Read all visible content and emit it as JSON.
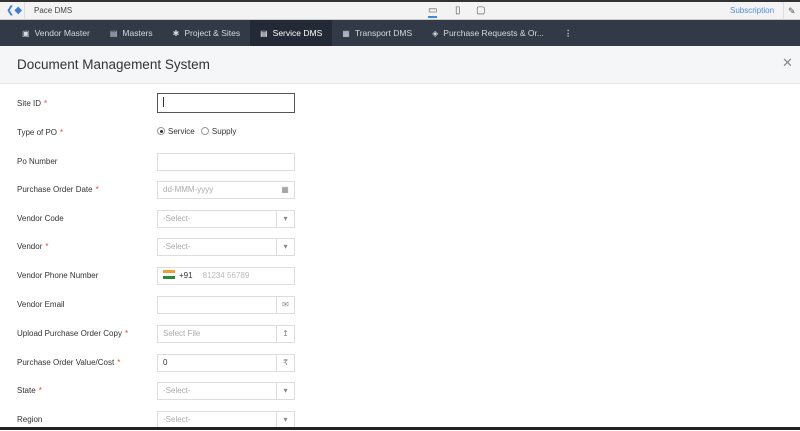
{
  "app": {
    "name": "Pace DMS",
    "subscription": "Subscription"
  },
  "nav": {
    "tabs": [
      {
        "label": "Vendor Master",
        "icon": "monitor-icon"
      },
      {
        "label": "Masters",
        "icon": "database-icon"
      },
      {
        "label": "Project & Sites",
        "icon": "bug-icon"
      },
      {
        "label": "Service DMS",
        "icon": "document-icon"
      },
      {
        "label": "Transport DMS",
        "icon": "bus-icon"
      },
      {
        "label": "Purchase Requests & Or...",
        "icon": "tag-icon"
      }
    ],
    "active": "Service DMS"
  },
  "page": {
    "title": "Document Management System"
  },
  "form": {
    "site_id": {
      "label": "Site ID",
      "value": ""
    },
    "type_of_po": {
      "label": "Type of PO",
      "options": [
        "Service",
        "Supply"
      ],
      "selected": "Service"
    },
    "po_number": {
      "label": "Po Number",
      "value": ""
    },
    "po_date": {
      "label": "Purchase Order Date",
      "placeholder": "dd-MMM-yyyy"
    },
    "vendor_code": {
      "label": "Vendor Code",
      "value": "-Select-"
    },
    "vendor": {
      "label": "Vendor",
      "value": "-Select-"
    },
    "vendor_phone": {
      "label": "Vendor Phone Number",
      "code": "+91",
      "placeholder": "81234 56789"
    },
    "vendor_email": {
      "label": "Vendor Email",
      "value": ""
    },
    "upload": {
      "label": "Upload Purchase Order Copy",
      "placeholder": "Select File"
    },
    "po_value": {
      "label": "Purchase Order Value/Cost",
      "value": "0",
      "currency": "₹"
    },
    "state": {
      "label": "State",
      "value": "-Select-"
    },
    "region": {
      "label": "Region",
      "value": "-Select-"
    }
  },
  "required_mark": "*"
}
